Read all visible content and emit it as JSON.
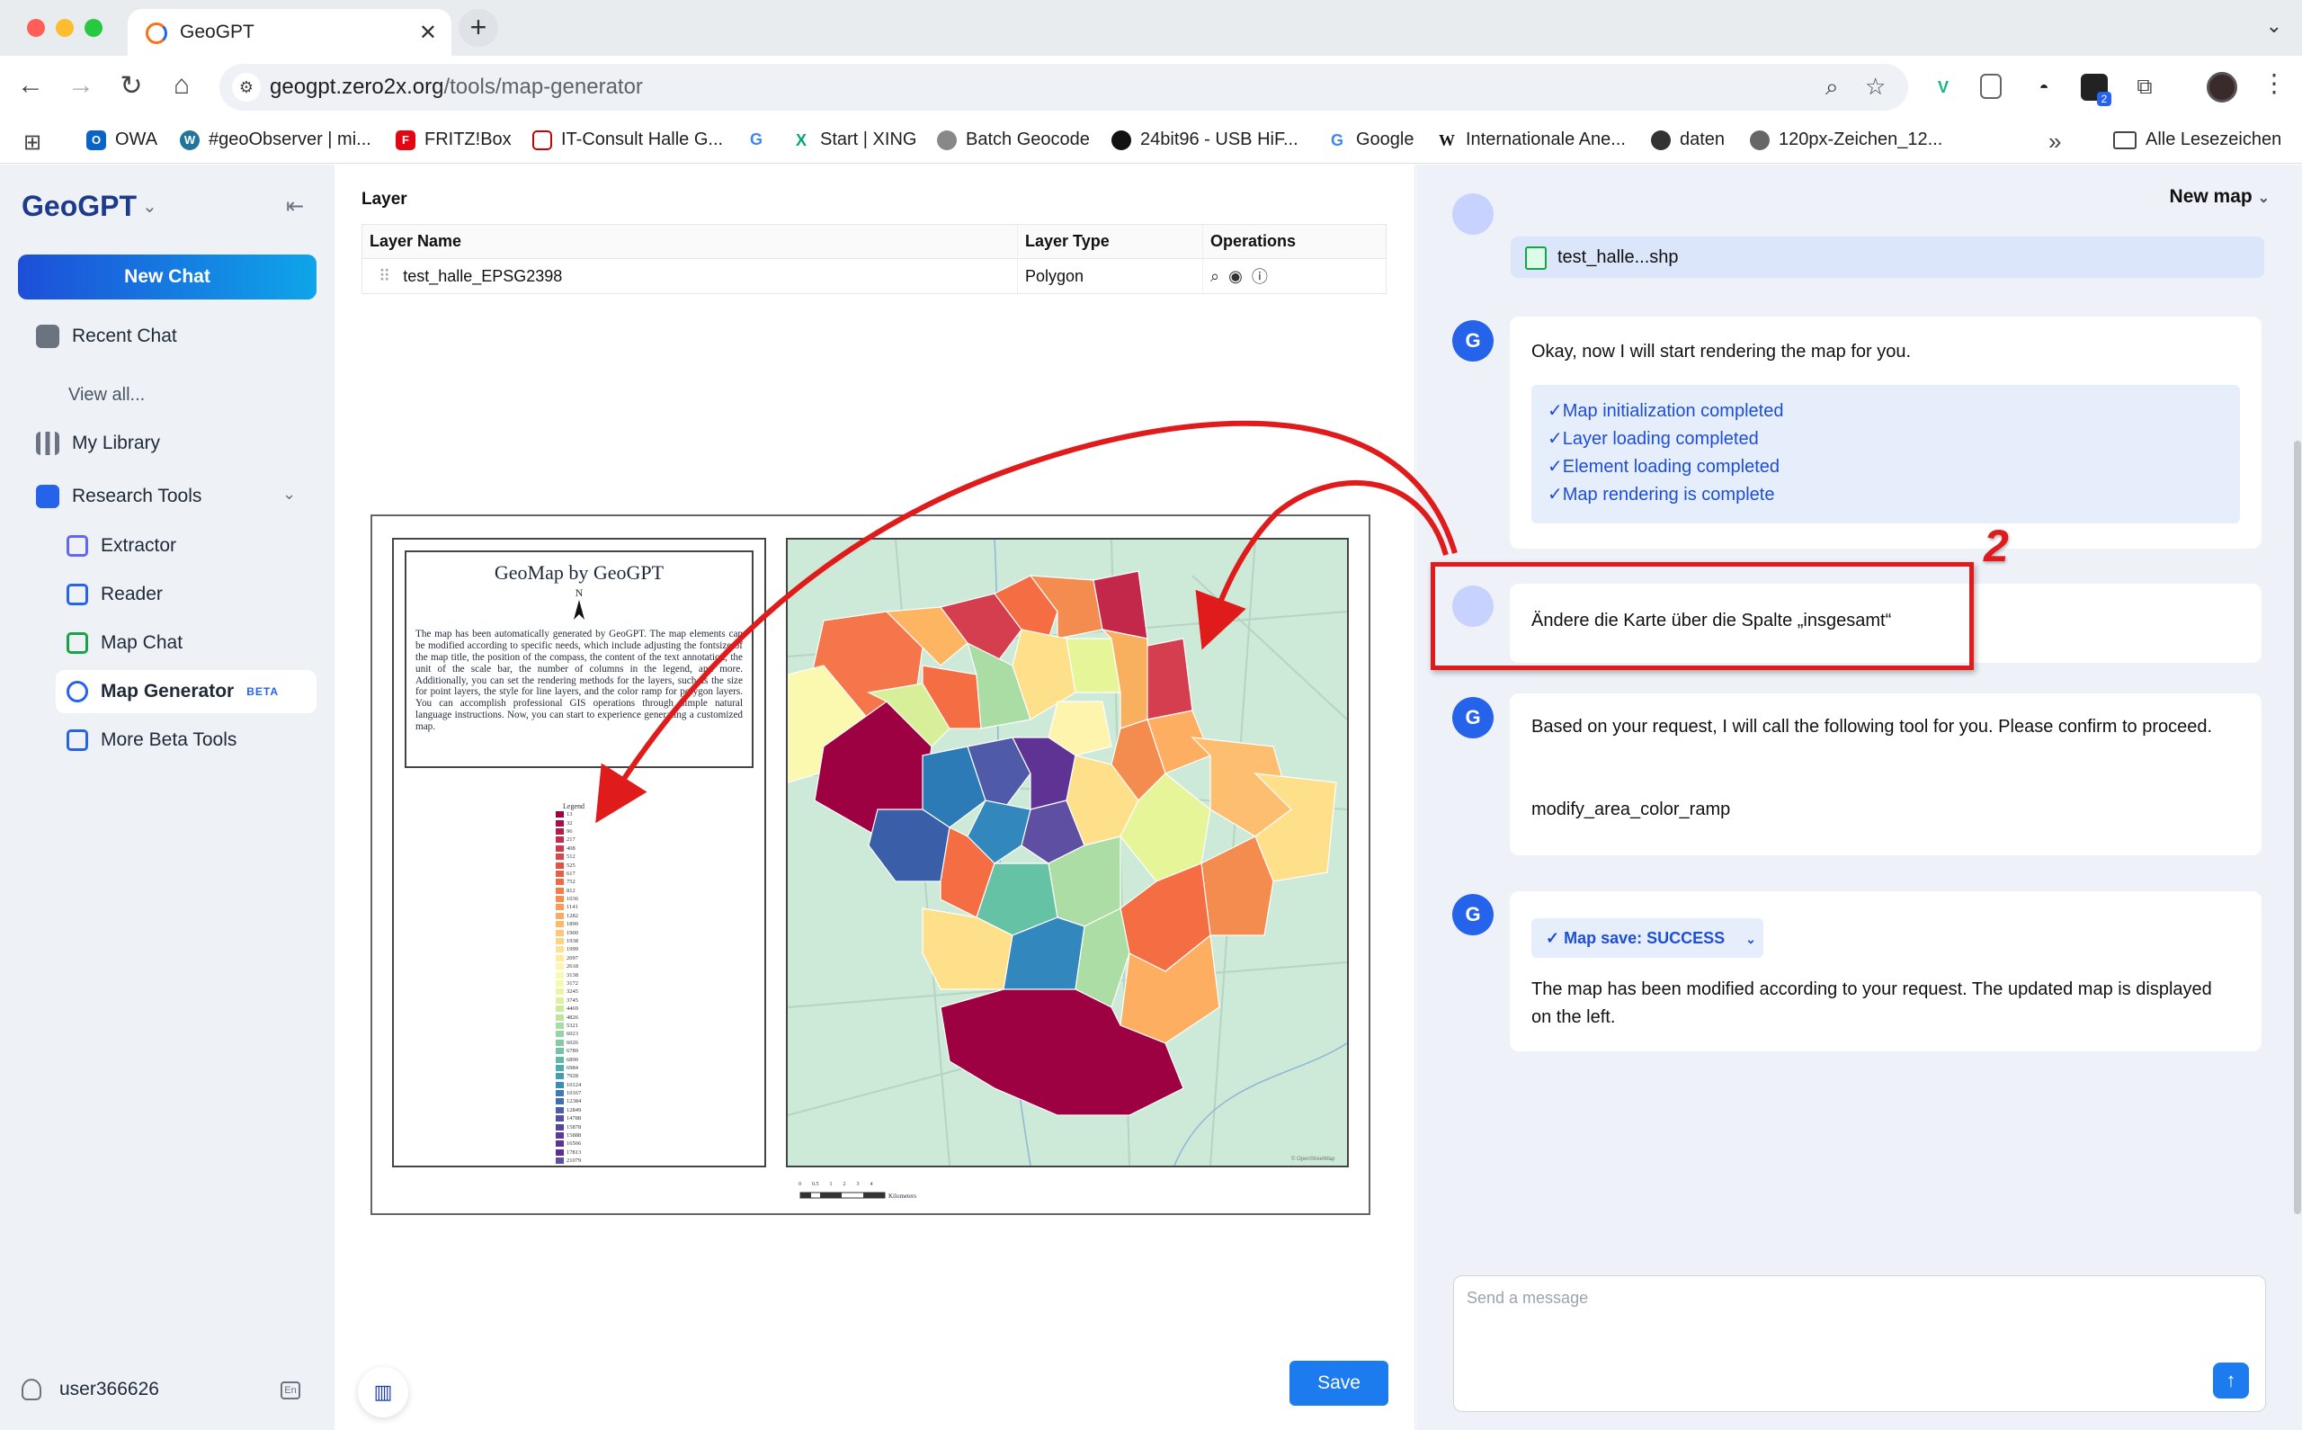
{
  "browser": {
    "tab_title": "GeoGPT",
    "url_host": "geogpt.zero2x.org",
    "url_path": "/tools/map-generator",
    "bookmarks": [
      "OWA",
      "#geoObserver | mi...",
      "FRITZ!Box",
      "IT-Consult Halle G...",
      "Start | XING",
      "Batch Geocode",
      "24bit96 - USB HiF...",
      "Google",
      "Internationale Ane...",
      "daten",
      "120px-Zeichen_12..."
    ],
    "all_bookmarks": "Alle Lesezeichen",
    "ext_badge": "2"
  },
  "sidebar": {
    "brand": "GeoGPT",
    "new_chat": "New Chat",
    "recent_chat": "Recent Chat",
    "view_all": "View all...",
    "my_library": "My Library",
    "research_tools": "Research Tools",
    "tools": [
      {
        "label": "Extractor",
        "color": "#6366f1"
      },
      {
        "label": "Reader",
        "color": "#2563eb"
      },
      {
        "label": "Map Chat",
        "color": "#16a34a"
      },
      {
        "label": "Map Generator",
        "color": "#2563eb",
        "badge": "BETA"
      },
      {
        "label": "More Beta Tools",
        "color": "#2563eb"
      }
    ],
    "username": "user366626",
    "lang": "En"
  },
  "layer_panel": {
    "title": "Layer",
    "columns": [
      "Layer Name",
      "Layer Type",
      "Operations"
    ],
    "rows": [
      {
        "name": "test_halle_EPSG2398",
        "type": "Polygon"
      }
    ]
  },
  "map": {
    "title": "GeoMap by GeoGPT",
    "north": "N",
    "description": "The map has been automatically generated by GeoGPT. The map elements can be modified according to specific needs, which include adjusting the fontsize of the map title, the position of the compass, the content of the text annotation, the unit of the scale bar, the number of columns in the legend, and more. Additionally, you can set the rendering methods for the layers, such as the size for point layers, the style for line layers, and the color ramp for polygon layers. You can accomplish professional GIS operations through simple natural language instructions. Now, you can start to experience generating a customized map.",
    "legend_title": "Legend",
    "legend": [
      {
        "label": "13",
        "color": "#9e0142"
      },
      {
        "label": "32",
        "color": "#a50f43"
      },
      {
        "label": "96",
        "color": "#b31e47"
      },
      {
        "label": "217",
        "color": "#c22e4a"
      },
      {
        "label": "408",
        "color": "#d0394d"
      },
      {
        "label": "512",
        "color": "#d8464b"
      },
      {
        "label": "525",
        "color": "#e05248"
      },
      {
        "label": "617",
        "color": "#e65e45"
      },
      {
        "label": "752",
        "color": "#ee6c44"
      },
      {
        "label": "812",
        "color": "#f47d48"
      },
      {
        "label": "1036",
        "color": "#f78c4f"
      },
      {
        "label": "1141",
        "color": "#fa9b57"
      },
      {
        "label": "1282",
        "color": "#fcab5e"
      },
      {
        "label": "1890",
        "color": "#fdba69"
      },
      {
        "label": "1900",
        "color": "#fec776"
      },
      {
        "label": "1938",
        "color": "#fed484"
      },
      {
        "label": "1999",
        "color": "#fee191"
      },
      {
        "label": "2097",
        "color": "#feeb9e"
      },
      {
        "label": "2618",
        "color": "#fef4ad"
      },
      {
        "label": "3138",
        "color": "#fbf8b0"
      },
      {
        "label": "3172",
        "color": "#f3faab"
      },
      {
        "label": "3245",
        "color": "#e9f6a2"
      },
      {
        "label": "3745",
        "color": "#dbf19c"
      },
      {
        "label": "4469",
        "color": "#cdeb9d"
      },
      {
        "label": "4826",
        "color": "#bce59f"
      },
      {
        "label": "5321",
        "color": "#aadda3"
      },
      {
        "label": "6023",
        "color": "#97d4a4"
      },
      {
        "label": "6026",
        "color": "#84cba5"
      },
      {
        "label": "6789",
        "color": "#72c3a7"
      },
      {
        "label": "6890",
        "color": "#61b8a8"
      },
      {
        "label": "6984",
        "color": "#51aaad"
      },
      {
        "label": "7928",
        "color": "#439bb4"
      },
      {
        "label": "10124",
        "color": "#3a8cba"
      },
      {
        "label": "10167",
        "color": "#3b7cb7"
      },
      {
        "label": "12384",
        "color": "#436db0"
      },
      {
        "label": "12849",
        "color": "#4b5ea9"
      },
      {
        "label": "14788",
        "color": "#5150a2"
      },
      {
        "label": "15878",
        "color": "#57449e"
      },
      {
        "label": "15888",
        "color": "#5c3a99"
      },
      {
        "label": "16566",
        "color": "#5e3394"
      },
      {
        "label": "17813",
        "color": "#5e2d8f"
      },
      {
        "label": "21079",
        "color": "#5e4fa2"
      }
    ],
    "scale_unit": "Kilometers",
    "scale_ticks": [
      "0",
      "0.5",
      "1",
      "2",
      "3",
      "4"
    ]
  },
  "buttons": {
    "save": "Save"
  },
  "chat": {
    "header": "New map",
    "file": "test_halle...shp",
    "msg1": "Okay, now I will start rendering the map for you.",
    "steps": [
      "Map initialization completed",
      "Layer loading completed",
      "Element loading completed",
      "Map rendering is complete"
    ],
    "user_msg": "Ändere die Karte über die Spalte „insgesamt“",
    "msg2": "Based on your request, I will call the following tool for you. Please confirm to proceed.",
    "tool": "modify_area_color_ramp",
    "status": "Map save: SUCCESS",
    "msg3": "The map has been modified according to your request. The updated map is displayed on the left.",
    "placeholder": "Send a message",
    "annotation": "2"
  }
}
